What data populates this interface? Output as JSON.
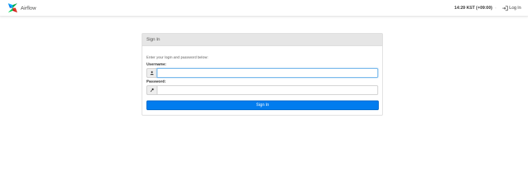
{
  "navbar": {
    "brand": "Airflow",
    "clock": "14:29 KST (+09:00)",
    "caret": "-",
    "login_label": "Log In"
  },
  "signin": {
    "heading": "Sign In",
    "hint": "Enter your login and password below:",
    "username_label": "Username:",
    "username_value": "",
    "password_label": "Password:",
    "password_value": "",
    "submit_label": "Sign In"
  },
  "colors": {
    "primary": "#017cee",
    "panel_heading": "#e6e6e6",
    "focus_border": "#66afe9"
  },
  "icons": {
    "brand": "airflow-pinwheel-icon",
    "login": "sign-in-icon",
    "username": "user-icon",
    "password": "key-icon"
  }
}
